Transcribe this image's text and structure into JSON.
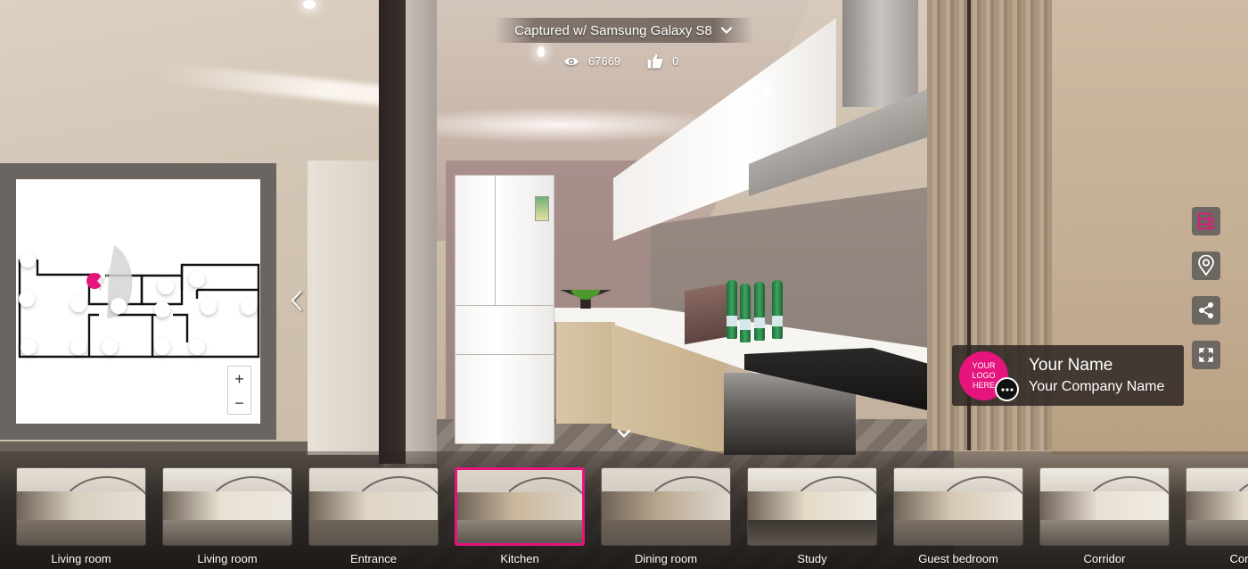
{
  "header": {
    "title": "Captured w/ Samsung Galaxy S8",
    "views": "67669",
    "likes": "0"
  },
  "minimap": {
    "zoom_in_label": "+",
    "zoom_out_label": "−",
    "current_marker_color": "#e6157d"
  },
  "tools": [
    {
      "name": "floorplan-toggle",
      "icon": "floorplan-icon",
      "active": true
    },
    {
      "name": "location",
      "icon": "map-pin-icon",
      "active": false
    },
    {
      "name": "share",
      "icon": "share-icon",
      "active": false
    },
    {
      "name": "fullscreen",
      "icon": "fullscreen-icon",
      "active": false
    }
  ],
  "profile": {
    "logo_text_1": "YOUR",
    "logo_text_2": "LOGO",
    "logo_text_3": "HERE",
    "name": "Your Name",
    "company": "Your Company Name"
  },
  "thumbnails": [
    {
      "label": "Living room",
      "active": false
    },
    {
      "label": "Living room",
      "active": false
    },
    {
      "label": "Entrance",
      "active": false
    },
    {
      "label": "Kitchen",
      "active": true
    },
    {
      "label": "Dining room",
      "active": false
    },
    {
      "label": "Study",
      "active": false
    },
    {
      "label": "Guest bedroom",
      "active": false
    },
    {
      "label": "Corridor",
      "active": false
    },
    {
      "label": "Corridor",
      "active": false
    }
  ],
  "colors": {
    "accent": "#e6157d",
    "panel": "#6b6562",
    "tool_bg": "#646060"
  }
}
